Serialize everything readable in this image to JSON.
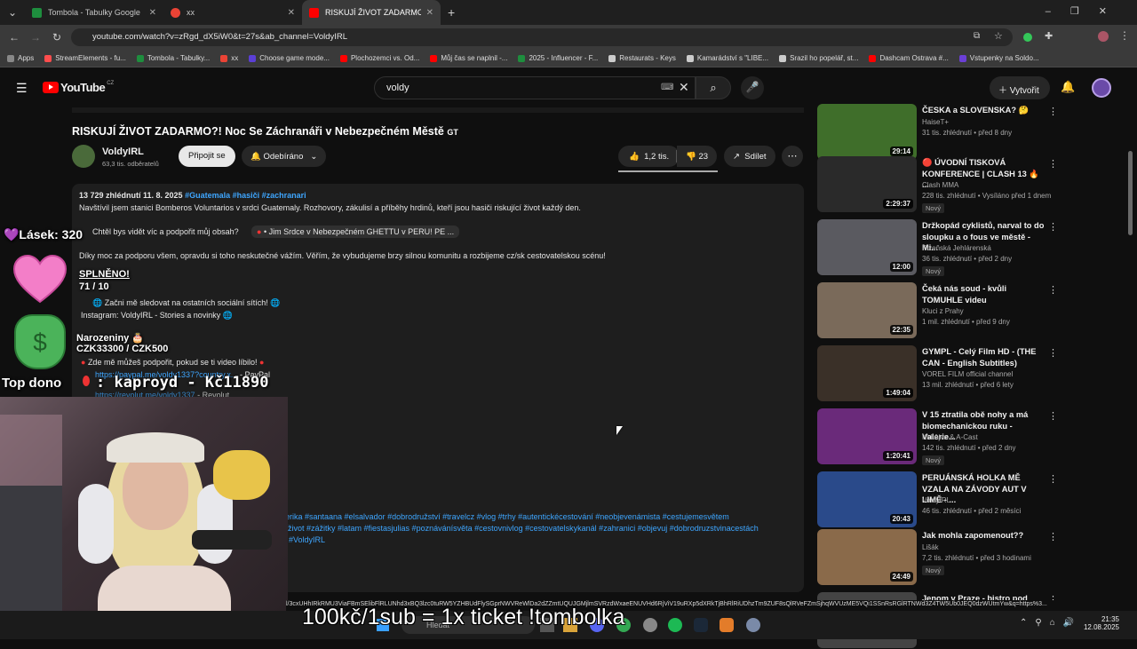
{
  "browser": {
    "tabs": [
      {
        "title": "Tombola - Tabulky Google",
        "color": "#1e8e3e"
      },
      {
        "title": "xx",
        "color": "#ea4335"
      },
      {
        "title": "RISKUJÍ ŽIVOT ZADARMO?! Ne",
        "color": "#ff0000"
      }
    ],
    "new_tab": "+",
    "url": "youtube.com/watch?v=zRgd_dX5iW0&t=27s&ab_channel=VoldyIRL",
    "bookmarks": [
      {
        "label": "Apps",
        "color": "#888"
      },
      {
        "label": "StreamElements - fu...",
        "color": "#ff4d4d"
      },
      {
        "label": "Tombola - Tabulky...",
        "color": "#1e8e3e"
      },
      {
        "label": "xx",
        "color": "#ea4335"
      },
      {
        "label": "Choose game mode...",
        "color": "#5b3fd6"
      },
      {
        "label": "Plochozemci vs. Od...",
        "color": "#ff0000"
      },
      {
        "label": "Můj čas se naplnil -...",
        "color": "#ff0000"
      },
      {
        "label": "2025 - Influencer - F...",
        "color": "#1e8e3e"
      },
      {
        "label": "Restaurats - Keys",
        "color": "#ccc"
      },
      {
        "label": "Kamarádství s \"LIBE...",
        "color": "#ccc"
      },
      {
        "label": "Srazil ho popelář, st...",
        "color": "#ccc"
      },
      {
        "label": "Dashcam Ostrava #...",
        "color": "#ff0000"
      },
      {
        "label": "Vstupenky na Soldo...",
        "color": "#6b3fd6"
      }
    ]
  },
  "youtube": {
    "logo": "YouTube",
    "region": "CZ",
    "search_value": "voldy",
    "create_label": "Vytvořit",
    "video_title": "RISKUJÍ ŽIVOT ZADARMO?! Noc Se Záchranáři v Nebezpečném Městě",
    "title_flag": "GT",
    "channel_name": "VoldyIRL",
    "subscribers": "63,3 tis. odběratelů",
    "join_label": "Připojit se",
    "subscribed_label": "Odebíráno",
    "likes": "1,2 tis.",
    "dislikes": "23",
    "share_label": "Sdílet",
    "description": {
      "meta_views": "13 729 zhlédnutí  11. 8. 2025",
      "meta_tags": "#Guatemala #hasiči #zachranari",
      "line1": "Navštívil jsem stanici Bomberos Voluntarios v srdci Guatemaly. Rozhovory, zákulisí a příběhy hrdinů, kteří jsou hasiči riskující život každý den.",
      "chip_prompt": "Chtěl bys vidět víc a podpořit můj obsah?",
      "chip_text": "• Jim Srdce v Nebezpečném GHETTU v PERU! PE ...",
      "line2": "Díky moc za podporu všem, opravdu si toho neskutečné vážím. Věřím, že vybudujeme brzy silnou komunitu a rozbijeme cz/sk cestovatelskou scénu!",
      "follow": "Začni mě sledovat na ostatních sociální sítích!",
      "instagram": "Instagram:  VoldyIRL     - Stories a novinky",
      "support": "Zde mě můžeš podpořit, pokud se ti video líbilo!",
      "paypal_link": "https://paypal.me/voldy1337?country.x...",
      "paypal_label": "- PayPal",
      "revolut_link": "https://revolut.me/voldy1337",
      "revolut_label": "- Revolut",
      "hashtags1": "erika #santaana #elsalvador #dobrodružství #travelcz #vlog #trhy #autentickécestování #neobjevenámista #cestujemesvětem",
      "hashtags2": "život #zážitky #latam #fiestasjulias #poznávánísvěta #cestovnivlog #cestovatelskykanál #zahranici #objevuj #dobrodruzstvinacestách",
      "hashtags3": "#VoldyIRL"
    },
    "related": [
      {
        "title": "ČESKA a SLOVENSKA? 🤔",
        "channel": "HaiseT+",
        "meta": "31 tis. zhlédnutí • před 8 dny",
        "duration": "29:14",
        "badge": "",
        "bg": "#3f6e2a"
      },
      {
        "title": "🔴 ÚVODNÍ TISKOVÁ KONFERENCE | CLASH 13 🔥 ...",
        "channel": "Clash MMA",
        "meta": "228 tis. zhlédnutí • Vysíláno před 1 dnem",
        "duration": "2:29:37",
        "badge": "Nový",
        "bg": "#2a2a2a"
      },
      {
        "title": "Držkopád cyklistů, narval to do sloupku a o fous ve městě - Mi...",
        "channel": "Plzeňská Jehlárenská",
        "meta": "36 tis. zhlédnutí • před 2 dny",
        "duration": "12:00",
        "badge": "Nový",
        "bg": "#5a5a60"
      },
      {
        "title": "Čeká nás soud - kvůli TOMUHLE videu",
        "channel": "Kluci z Prahy",
        "meta": "1 mil. zhlédnutí • před 9 dny",
        "duration": "22:35",
        "badge": "",
        "bg": "#7a6a5a"
      },
      {
        "title": "GYMPL - Celý Film HD - (THE CAN - English Subtitles)",
        "channel": "VOREL FILM official channel",
        "meta": "13 mil. zhlédnutí • před 6 lety",
        "duration": "1:49:04",
        "badge": "",
        "bg": "#3a3028"
      },
      {
        "title": "V 15 ztratila obě nohy a má biomechanickou ruku - Valerie...",
        "channel": "Kid Ajvn & A-Cast",
        "meta": "142 tis. zhlédnutí • před 2 dny",
        "duration": "1:20:41",
        "badge": "Nový",
        "bg": "#6a2a7a"
      },
      {
        "title": "PERUÁNSKÁ HOLKA MĚ VZALA NA ZÁVODY AUT V LIMĚ - ...",
        "channel": "VoldyIRL",
        "meta": "46 tis. zhlédnutí • před 2 měsíci",
        "duration": "20:43",
        "badge": "",
        "bg": "#2a4a8a"
      },
      {
        "title": "Jak mohla zapomenout??",
        "channel": "Lišák",
        "meta": "7,2 tis. zhlédnutí • před 3 hodinami",
        "duration": "24:49",
        "badge": "Nový",
        "bg": "#8a6a4a"
      },
      {
        "title": "Jenom v Praze - bistro pod",
        "channel": "",
        "meta": "",
        "duration": "",
        "badge": "",
        "bg": "#444"
      }
    ]
  },
  "stream_overlay": {
    "hearts": "💜Lásek: 320",
    "goal_done": "SPLNĚNO!",
    "goal_count": "71 / 10",
    "birthday": "Narozeniny 🎂",
    "birthday_goal": "CZK33300 / CZK500",
    "top_donor": "Top dono",
    "top_donor_value": ": kaproyd - Kč11890",
    "bottom_text": "100kč/1sub = 1x ticket !tombolka",
    "ticker": "l/3cxUHhIRkRMU3ViaFBmSElibFlRLUNhd3xBQ3lzc0tuRW5YZHBUdFlySGprNWVReWlDa2dZZmtUQUJGMjlmSVRzdWxaeENUVHd6RjViV19uRXp5dXRkTjBhRlRiUDhzTm9ZUF8sQlRVeFZmSjhqWVUzME5VQi1SSnRsRGlRTNWd3Z4TW5Ub0JEQ0dzWUtmYw&q=https%3..."
  },
  "taskbar": {
    "search_label": "Hledat",
    "time": "21:35",
    "date": "12.08.2025"
  }
}
